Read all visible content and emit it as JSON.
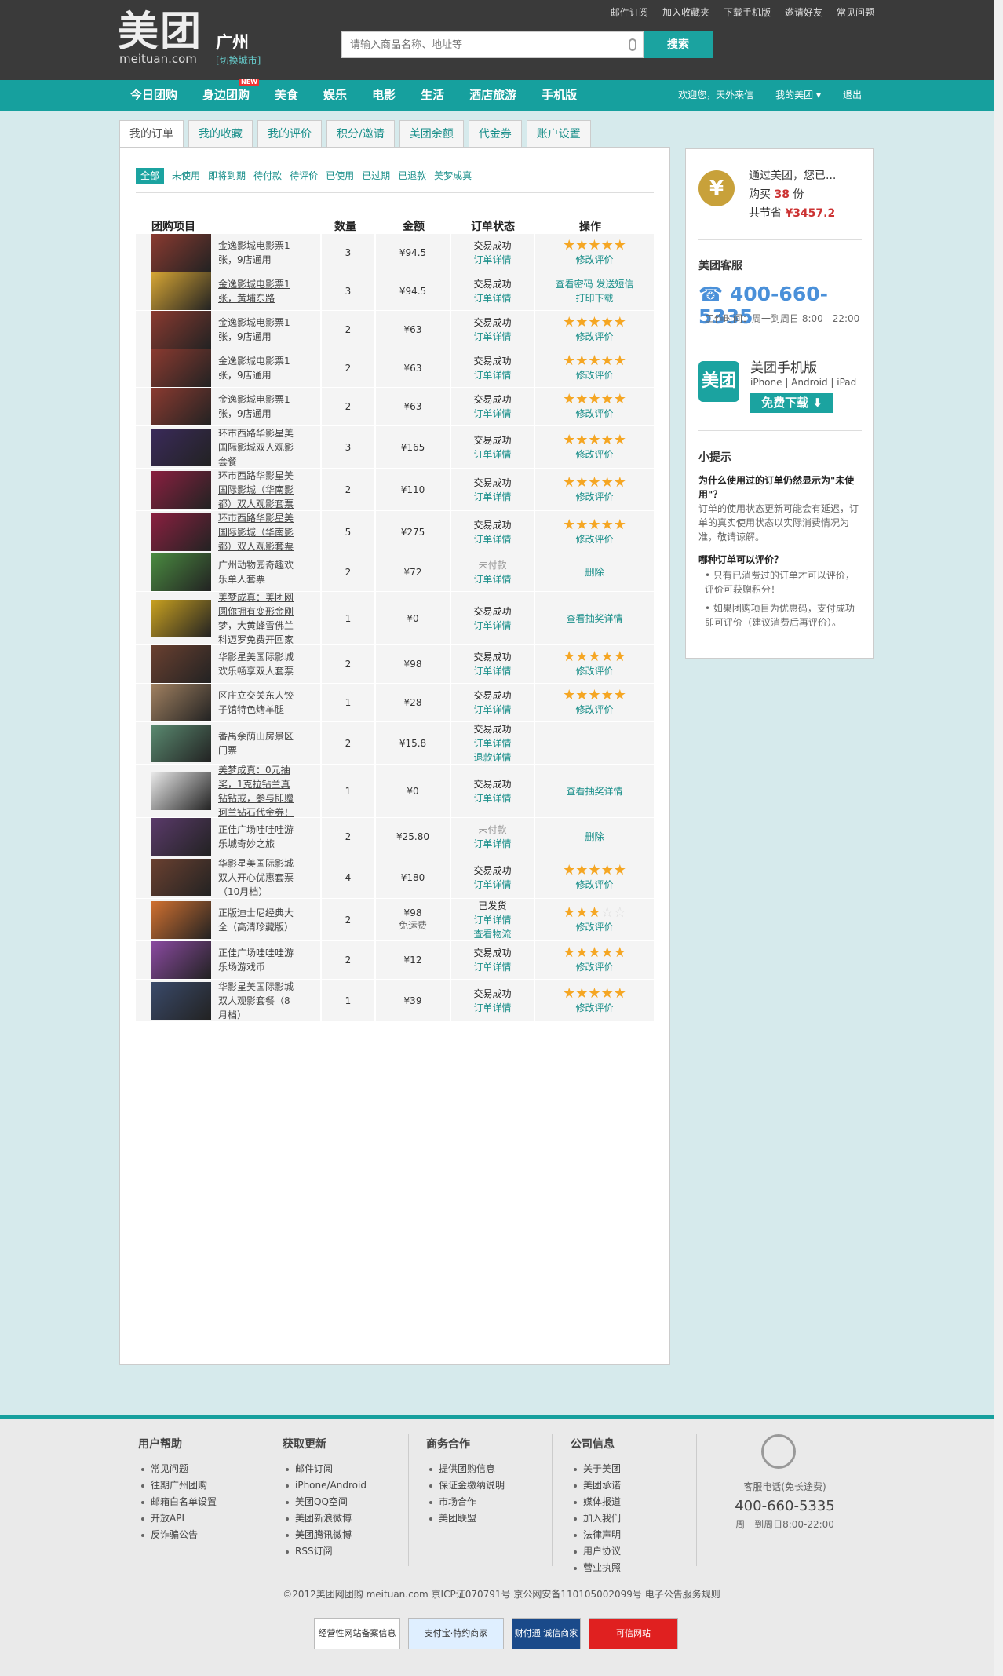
{
  "header": {
    "logo_cn": "美团",
    "logo_en": "meituan.com",
    "city": "广州",
    "switch_city": "[切换城市]",
    "search_placeholder": "请输入商品名称、地址等",
    "search_btn": "搜索",
    "toplinks": [
      "邮件订阅",
      "加入收藏夹",
      "下载手机版",
      "邀请好友",
      "常见问题"
    ]
  },
  "nav": {
    "items": [
      "今日团购",
      "身边团购",
      "美食",
      "娱乐",
      "电影",
      "生活",
      "酒店旅游",
      "手机版"
    ],
    "new_badge": "NEW",
    "welcome": "欢迎您，天外来信",
    "my": "我的美团",
    "logout": "退出"
  },
  "tabs": [
    "我的订单",
    "我的收藏",
    "我的评价",
    "积分/邀请",
    "美团余额",
    "代金券",
    "账户设置"
  ],
  "filters": [
    "全部",
    "未使用",
    "即将到期",
    "待付款",
    "待评价",
    "已使用",
    "已过期",
    "已退款",
    "美梦成真"
  ],
  "table_headers": [
    "团购项目",
    "数量",
    "金额",
    "订单状态",
    "操作"
  ],
  "orders": [
    {
      "name": "金逸影城电影票1张，9店通用",
      "qty": "3",
      "amount": "¥94.5",
      "status": "交易成功",
      "detail": "订单详情",
      "op": "stars5",
      "op_link": "修改评价",
      "h": 49,
      "color": "#8a3a30"
    },
    {
      "name": "金逸影城电影票1张，黄埔东路",
      "qty": "3",
      "amount": "¥94.5",
      "status": "交易成功",
      "detail": "订单详情",
      "op": "links",
      "op_links": [
        "查看密码",
        "发送短信",
        "打印下载"
      ],
      "h": 49,
      "color": "#d6a534",
      "u": true
    },
    {
      "name": "金逸影城电影票1张，9店通用",
      "qty": "2",
      "amount": "¥63",
      "status": "交易成功",
      "detail": "订单详情",
      "op": "stars5",
      "op_link": "修改评价",
      "h": 49,
      "color": "#8a3a30"
    },
    {
      "name": "金逸影城电影票1张，9店通用",
      "qty": "2",
      "amount": "¥63",
      "status": "交易成功",
      "detail": "订单详情",
      "op": "stars5",
      "op_link": "修改评价",
      "h": 49,
      "color": "#8a3a30"
    },
    {
      "name": "金逸影城电影票1张，9店通用",
      "qty": "2",
      "amount": "¥63",
      "status": "交易成功",
      "detail": "订单详情",
      "op": "stars5",
      "op_link": "修改评价",
      "h": 49,
      "color": "#8a3a30"
    },
    {
      "name": "环市西路华影星美国际影城双人观影套餐",
      "qty": "3",
      "amount": "¥165",
      "status": "交易成功",
      "detail": "订单详情",
      "op": "stars5",
      "op_link": "修改评价",
      "h": 54,
      "color": "#3a2a5a"
    },
    {
      "name": "环市西路华影星美国际影城（华南影都）双人观影套票",
      "qty": "2",
      "amount": "¥110",
      "status": "交易成功",
      "detail": "订单详情",
      "op": "stars5",
      "op_link": "修改评价",
      "h": 54,
      "color": "#8a2040",
      "u": true
    },
    {
      "name": "环市西路华影星美国际影城（华南影都）双人观影套票",
      "qty": "5",
      "amount": "¥275",
      "status": "交易成功",
      "detail": "订单详情",
      "op": "stars5",
      "op_link": "修改评价",
      "h": 54,
      "color": "#8a2040",
      "u": true
    },
    {
      "name": "广州动物园奇趣欢乐单人套票",
      "qty": "2",
      "amount": "¥72",
      "status": "未付款",
      "detail": "订单详情",
      "op": "delete",
      "op_link": "删除",
      "h": 49,
      "color": "#4a8a40",
      "gray": true
    },
    {
      "name": "美梦成真：美团网圆你拥有变形金刚梦，大黄蜂雪佛兰科迈罗免费开回家",
      "qty": "1",
      "amount": "¥0",
      "status": "交易成功",
      "detail": "订单详情",
      "op": "text",
      "op_link": "查看抽奖详情",
      "h": 68,
      "color": "#c8a020",
      "u": true
    },
    {
      "name": "华影星美国际影城欢乐畅享双人套票",
      "qty": "2",
      "amount": "¥98",
      "status": "交易成功",
      "detail": "订单详情",
      "op": "stars5",
      "op_link": "修改评价",
      "h": 49,
      "color": "#6a4030"
    },
    {
      "name": "区庄立交关东人饺子馆特色烤羊腿",
      "qty": "1",
      "amount": "¥28",
      "status": "交易成功",
      "detail": "订单详情",
      "op": "stars5",
      "op_link": "修改评价",
      "h": 49,
      "color": "#a08060"
    },
    {
      "name": "番禺余荫山房景区门票",
      "qty": "2",
      "amount": "¥15.8",
      "status": "交易成功",
      "detail": "订单详情",
      "detail2": "退款详情",
      "op": "none",
      "h": 54,
      "color": "#5a8a70"
    },
    {
      "name": "美梦成真：0元抽奖，1克拉钻兰真钻钻戒，参与即赠珂兰钻石代金券！",
      "qty": "1",
      "amount": "¥0",
      "status": "交易成功",
      "detail": "订单详情",
      "op": "text",
      "op_link": "查看抽奖详情",
      "h": 68,
      "color": "#e8e8e8",
      "u": true
    },
    {
      "name": "正佳广场哇哇哇游乐城奇妙之旅",
      "qty": "2",
      "amount": "¥25.80",
      "status": "未付款",
      "detail": "订单详情",
      "op": "delete",
      "op_link": "删除",
      "h": 49,
      "color": "#5a3a6a",
      "gray": true
    },
    {
      "name": "华影星美国际影城双人开心优惠套票（10月档）",
      "qty": "4",
      "amount": "¥180",
      "status": "交易成功",
      "detail": "订单详情",
      "op": "stars5",
      "op_link": "修改评价",
      "h": 54,
      "color": "#6a4030"
    },
    {
      "name": "正版迪士尼经典大全（高清珍藏版）",
      "qty": "2",
      "amount": "¥98",
      "amount_sub": "免运费",
      "status": "已发货",
      "detail": "订单详情",
      "detail2": "查看物流",
      "op": "stars3",
      "op_link": "修改评价",
      "h": 54,
      "color": "#d07030"
    },
    {
      "name": "正佳广场哇哇哇游乐场游戏币",
      "qty": "2",
      "amount": "¥12",
      "status": "交易成功",
      "detail": "订单详情",
      "op": "stars5",
      "op_link": "修改评价",
      "h": 49,
      "color": "#8a4aa0"
    },
    {
      "name": "华影星美国际影城双人观影套餐（8月档）",
      "qty": "1",
      "amount": "¥39",
      "status": "交易成功",
      "detail": "订单详情",
      "op": "stars5",
      "op_link": "修改评价",
      "h": 54,
      "color": "#3a4a6a"
    }
  ],
  "side": {
    "saved_line1": "通过美团，您已...",
    "buy_pre": "购买",
    "buy_num": "38",
    "buy_unit": "份",
    "save_pre": "共节省",
    "save_amount": "¥3457.2",
    "cs_title": "美团客服",
    "phone": "400-660-5335",
    "worktime": "工作时间：周一到周日 8:00 - 22:00",
    "app_icon": "美团",
    "app_title": "美团手机版",
    "platforms": "iPhone | Android | iPad",
    "download": "免费下载",
    "tips_title": "小提示",
    "q1": "为什么使用过的订单仍然显示为\"未使用\"？",
    "a1": "订单的使用状态更新可能会有延迟，订单的真实使用状态以实际消费情况为准，敬请谅解。",
    "q2": "哪种订单可以评价？",
    "li1": "只有已消费过的订单才可以评价，评价可获赠积分！",
    "li2": "如果团购项目为优惠码，支付成功即可评价（建议消费后再评价）。"
  },
  "footer": {
    "cols": [
      {
        "h": "用户帮助",
        "items": [
          "常见问题",
          "往期广州团购",
          "邮箱白名单设置",
          "开放API",
          "反诈骗公告"
        ]
      },
      {
        "h": "获取更新",
        "items": [
          "邮件订阅",
          "iPhone/Android",
          "美团QQ空间",
          "美团新浪微博",
          "美团腾讯微博",
          "RSS订阅"
        ]
      },
      {
        "h": "商务合作",
        "items": [
          "提供团购信息",
          "保证金缴纳说明",
          "市场合作",
          "美团联盟"
        ]
      },
      {
        "h": "公司信息",
        "items": [
          "关于美团",
          "美团承诺",
          "媒体报道",
          "加入我们",
          "法律声明",
          "用户协议",
          "营业执照"
        ]
      }
    ],
    "cs_label": "客服电话(免长途费)",
    "cs_phone": "400-660-5335",
    "cs_time": "周一到周日8:00-22:00",
    "copyright": "©2012美团网团购 meituan.com 京ICP证070791号 京公网安备110105002099号 电子公告服务规则",
    "badges": [
      "经营性网站备案信息",
      "支付宝·特约商家",
      "财付通 诚信商家",
      "可信网站"
    ]
  }
}
